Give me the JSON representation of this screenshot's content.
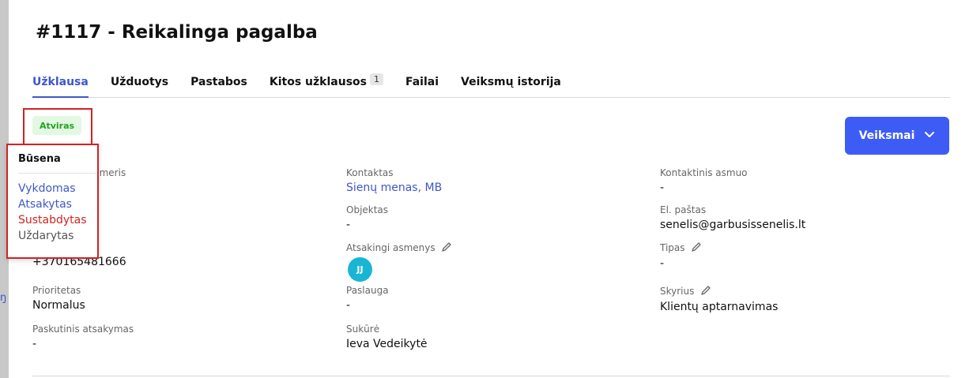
{
  "sidebar": {
    "stub_text": "ŋ"
  },
  "header": {
    "title": "#1117 - Reikalinga pagalba"
  },
  "tabs": [
    {
      "label": "Užklausa",
      "active": true
    },
    {
      "label": "Užduotys"
    },
    {
      "label": "Pastabos"
    },
    {
      "label": "Kitos užklausos",
      "count": "1"
    },
    {
      "label": "Failai"
    },
    {
      "label": "Veiksmų istorija"
    }
  ],
  "status": {
    "badge": "Atviras",
    "badge_color": "#23a31f"
  },
  "actions": {
    "label": "Veiksmai",
    "color": "#3d5cf5",
    "icon": "chevron-down-icon"
  },
  "dropdown": {
    "title": "Būsena",
    "items": [
      {
        "label": "Vykdomas",
        "color": "#3d57c9"
      },
      {
        "label": "Atsakytas",
        "color": "#3d57c9"
      },
      {
        "label": "Sustabdytas",
        "color": "#d32222"
      },
      {
        "label": "Uždarytas",
        "color": "#555555"
      }
    ]
  },
  "fields": {
    "partial_label": "umeris",
    "phone": "+370165481666",
    "priority_label": "Prioritetas",
    "priority": "Normalus",
    "last_reply_label": "Paskutinis atsakymas",
    "last_reply": "-",
    "contact_label": "Kontaktas",
    "contact": "Sienų menas, MB",
    "object_label": "Objektas",
    "object": "-",
    "responsible_label": "Atsakingi asmenys",
    "responsible_avatar": "JJ",
    "service_label": "Paslauga",
    "service": "-",
    "created_by_label": "Sukūrė",
    "created_by": "Ieva Vedeikytė",
    "contact_person_label": "Kontaktinis asmuo",
    "contact_person": "-",
    "email_label": "El. paštas",
    "email": "senelis@garbusissenelis.lt",
    "type_label": "Tipas",
    "type": "-",
    "department_label": "Skyrius",
    "department": "Klientų aptarnavimas"
  }
}
